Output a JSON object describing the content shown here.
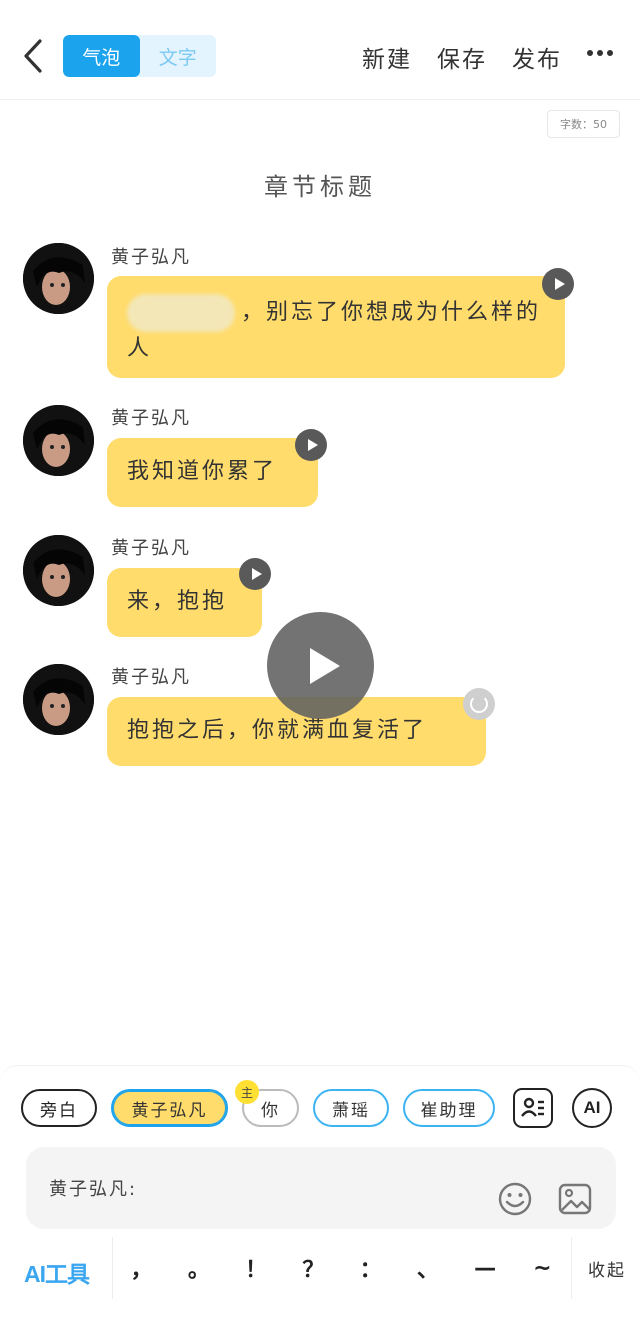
{
  "header": {
    "tabs": [
      {
        "label": "气泡",
        "active": true
      },
      {
        "label": "文字",
        "active": false
      }
    ],
    "actions": {
      "new": "新建",
      "save": "保存",
      "publish": "发布"
    }
  },
  "word_count": "字数：50",
  "chapter_title": "章节标题",
  "messages": [
    {
      "speaker": "黄子弘凡",
      "text": "，别忘了你想成为什么样的人"
    },
    {
      "speaker": "黄子弘凡",
      "text": "我知道你累了"
    },
    {
      "speaker": "黄子弘凡",
      "text": "来，抱抱"
    },
    {
      "speaker": "黄子弘凡",
      "text": "抱抱之后，你就满血复活了"
    }
  ],
  "roles": [
    {
      "label": "旁白"
    },
    {
      "label": "黄子弘凡",
      "selected": true
    },
    {
      "label": "你",
      "badge": "主"
    },
    {
      "label": "萧瑶"
    },
    {
      "label": "崔助理"
    }
  ],
  "tool_icons": [
    "role-list-icon",
    "ai-icon"
  ],
  "ai_label": "AI",
  "input": {
    "prefix": "黄子弘凡:"
  },
  "bottom": {
    "ai_tools": "AI工具",
    "punctuation": [
      "，",
      "。",
      "！",
      "？",
      "：",
      "、",
      "—",
      "~"
    ],
    "collapse": "收起"
  },
  "colors": {
    "accent": "#1ca3ee",
    "bubble": "#ffdc6b"
  }
}
